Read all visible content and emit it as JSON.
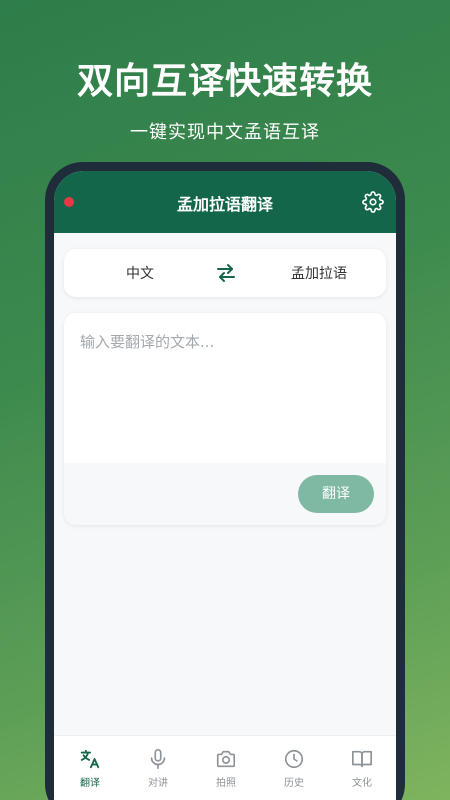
{
  "promo": {
    "title": "双向互译快速转换",
    "subtitle": "一键实现中文孟语互译"
  },
  "header": {
    "title": "孟加拉语翻译",
    "settings_icon": "gear-icon",
    "status_dot_color": "#e53945",
    "bg_color": "#14664a"
  },
  "languages": {
    "source": "中文",
    "target": "孟加拉语",
    "swap_icon": "swap-arrows-icon"
  },
  "input": {
    "placeholder": "输入要翻译的文本...",
    "value": ""
  },
  "actions": {
    "translate_label": "翻译"
  },
  "tabs": [
    {
      "label": "翻译",
      "icon": "translate-icon",
      "active": true
    },
    {
      "label": "对讲",
      "icon": "microphone-icon",
      "active": false
    },
    {
      "label": "拍照",
      "icon": "camera-icon",
      "active": false
    },
    {
      "label": "历史",
      "icon": "clock-icon",
      "active": false
    },
    {
      "label": "文化",
      "icon": "book-icon",
      "active": false
    }
  ],
  "colors": {
    "accent": "#14664a",
    "button": "#7fb8a3"
  }
}
